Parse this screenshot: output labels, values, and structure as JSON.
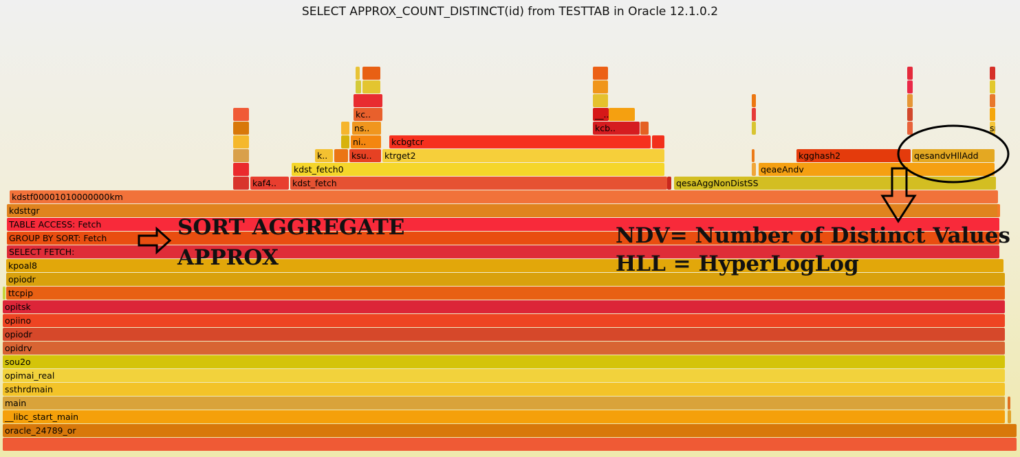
{
  "title": "SELECT APPROX_COUNT_DISTINCT(id) from TESTTAB in Oracle 12.1.0.2",
  "annotations": {
    "sort_line1": "SORT AGGREGATE",
    "sort_line2": "APPROX",
    "ndv": "NDV= Number of Distinct Values",
    "hll": "HLL = HyperLogLog"
  },
  "frames": [
    {
      "label": "",
      "color": "#ef5a35"
    },
    {
      "label": "oracle_24789_or",
      "color": "#d8780a"
    },
    {
      "label": "__libc_start_main",
      "color": "#f5a00a"
    },
    {
      "label": "",
      "color": "#e2a32c"
    },
    {
      "label": "main",
      "color": "#d9a33a"
    },
    {
      "label": "",
      "color": "#e07020"
    },
    {
      "label": "ssthrdmain",
      "color": "#f3c329"
    },
    {
      "label": "opimai_real",
      "color": "#f2d23c"
    },
    {
      "label": "sou2o",
      "color": "#d4c40a"
    },
    {
      "label": "opidrv",
      "color": "#d86433"
    },
    {
      "label": "opiodr",
      "color": "#d6482a"
    },
    {
      "label": "opiino",
      "color": "#ee4422"
    },
    {
      "label": "opitsk",
      "color": "#dc2538"
    },
    {
      "label": "",
      "color": "#c8d43a"
    },
    {
      "label": "ttcpip",
      "color": "#e86013"
    },
    {
      "label": "opiodr",
      "color": "#d9a10d"
    },
    {
      "label": "kpoal8",
      "color": "#e2a70a"
    },
    {
      "label": "SELECT FETCH:",
      "color": "#df2d38"
    },
    {
      "label": "GROUP BY SORT: Fetch",
      "color": "#e94e10"
    },
    {
      "label": "TABLE ACCESS: Fetch",
      "color": "#f82a3a"
    },
    {
      "label": "kdsttgr",
      "color": "#e0831e"
    },
    {
      "label": "",
      "color": "#f27b27"
    },
    {
      "label": "kdstf00001010000000km",
      "color": "#f1723a"
    },
    {
      "label": "",
      "color": "#d8342c"
    },
    {
      "label": "kaf4..",
      "color": "#e83e2f"
    },
    {
      "label": "kdst_fetch",
      "color": "#e65232"
    },
    {
      "label": "",
      "color": "#c8281e"
    },
    {
      "label": "qesaAggNonDistSS",
      "color": "#d3be22"
    },
    {
      "label": "",
      "color": "#ea2a2c"
    },
    {
      "label": "kdst_fetch0",
      "color": "#f5d62a"
    },
    {
      "label": "",
      "color": "#f0a538"
    },
    {
      "label": "qeaeAndv",
      "color": "#f5a012"
    },
    {
      "label": "",
      "color": "#d9a04a"
    },
    {
      "label": "k..",
      "color": "#f3c131"
    },
    {
      "label": "",
      "color": "#eb7515"
    },
    {
      "label": "ksu..",
      "color": "#e64123"
    },
    {
      "label": "ktrget2",
      "color": "#f6cf3a"
    },
    {
      "label": "",
      "color": "#eb7a18"
    },
    {
      "label": "kgghash2",
      "color": "#e43b0c"
    },
    {
      "label": "qesandvHllAdd",
      "color": "#e4a822"
    },
    {
      "label": "",
      "color": "#f5b82c"
    },
    {
      "label": "",
      "color": "#d7b20d"
    },
    {
      "label": "",
      "color": "#d8780a"
    },
    {
      "label": "ni..",
      "color": "#f4860f"
    },
    {
      "label": "kcbgtcr",
      "color": "#f6301e"
    },
    {
      "label": "",
      "color": "#f2301c"
    },
    {
      "label": "",
      "color": "#f5b52d"
    },
    {
      "label": "",
      "color": "#f05a36"
    },
    {
      "label": "ns..",
      "color": "#f0961e"
    },
    {
      "label": "kcb..",
      "color": "#d51c20"
    },
    {
      "label": "",
      "color": "#e46023"
    },
    {
      "label": "",
      "color": "#d8c430"
    },
    {
      "label": "",
      "color": "#e8623a"
    },
    {
      "label": "sn..",
      "color": "#f4c53a"
    },
    {
      "label": "kc..",
      "color": "#e8602c"
    },
    {
      "label": "__..",
      "color": "#d61818"
    },
    {
      "label": "",
      "color": "#f5a010"
    },
    {
      "label": "",
      "color": "#e63a38"
    },
    {
      "label": "",
      "color": "#d2482c"
    },
    {
      "label": "",
      "color": "#f5a70c"
    },
    {
      "label": "",
      "color": "#e82c30"
    },
    {
      "label": "",
      "color": "#e3c530"
    },
    {
      "label": "",
      "color": "#d4ca3a"
    },
    {
      "label": "",
      "color": "#ec7712"
    },
    {
      "label": "",
      "color": "#e69636"
    },
    {
      "label": "",
      "color": "#e8782c"
    },
    {
      "label": "",
      "color": "#e5c12e"
    },
    {
      "label": "",
      "color": "#f0951a"
    },
    {
      "label": "",
      "color": "#ea2848"
    },
    {
      "label": "",
      "color": "#e3c82c"
    },
    {
      "label": "",
      "color": "#e86014"
    },
    {
      "label": "",
      "color": "#e8c336"
    },
    {
      "label": "",
      "color": "#ec6016"
    },
    {
      "label": "",
      "color": "#e42a3c"
    },
    {
      "label": "",
      "color": "#d63028"
    }
  ]
}
